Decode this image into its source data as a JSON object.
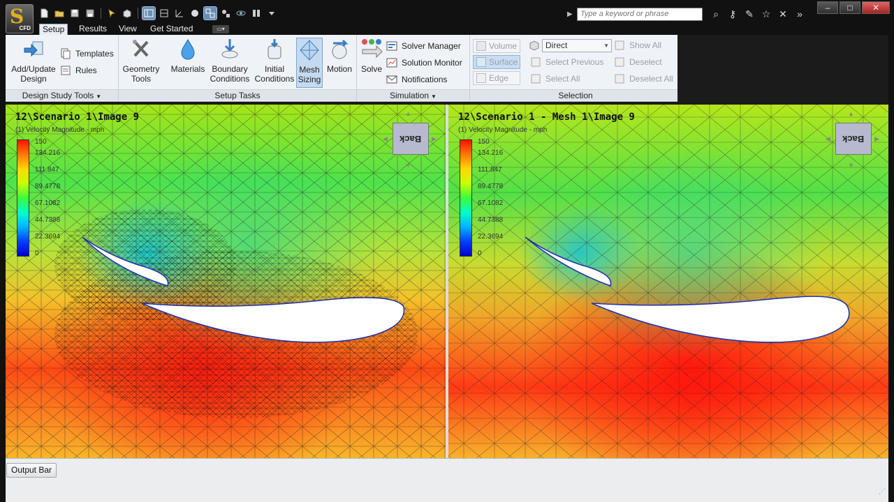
{
  "app": {
    "logo_letter": "S",
    "logo_sub": "CFD"
  },
  "search": {
    "placeholder": "Type a keyword or phrase"
  },
  "tabs": [
    "Setup",
    "Results",
    "View",
    "Get Started"
  ],
  "ribbon": {
    "design_study": {
      "add_update": "Add/Update Design",
      "templates": "Templates",
      "rules": "Rules",
      "title": "Design Study Tools"
    },
    "setup_tasks": {
      "geometry": "Geometry Tools",
      "materials": "Materials",
      "boundary": "Boundary Conditions",
      "initial": "Initial Conditions",
      "mesh": "Mesh Sizing",
      "motion": "Motion",
      "title": "Setup Tasks"
    },
    "simulation": {
      "solve": "Solve",
      "solver_manager": "Solver Manager",
      "solution_monitor": "Solution Monitor",
      "notifications": "Notifications",
      "title": "Simulation"
    },
    "selection": {
      "volume": "Volume",
      "surface": "Surface",
      "edge": "Edge",
      "direct": "Direct",
      "select_previous": "Select Previous",
      "select_all": "Select All",
      "show_all": "Show All",
      "deselect": "Deselect",
      "deselect_all": "Deselect All",
      "title": "Selection"
    }
  },
  "viewports": {
    "left": {
      "title": "12\\Scenario 1\\Image 9",
      "subtitle": "(1) Velocity Magnitude - mph",
      "legend": [
        "150",
        "134.216",
        "111.847",
        "89.4778",
        "67.1082",
        "44.7388",
        "22.3694",
        "0"
      ],
      "cube_face": "Back"
    },
    "right": {
      "title": "12\\Scenario 1 - Mesh 1\\Image 9",
      "subtitle": "(1) Velocity Magnitude - mph",
      "legend": [
        "150",
        "134.216",
        "111.847",
        "89.4778",
        "67.1082",
        "44.7388",
        "22.3694",
        "0"
      ],
      "cube_face": "Back"
    }
  },
  "output_bar": "Output Bar",
  "colors": {
    "ribbon_bg": "#eff2f6",
    "selected": "#c5daf0",
    "title_bar": "#111111"
  }
}
